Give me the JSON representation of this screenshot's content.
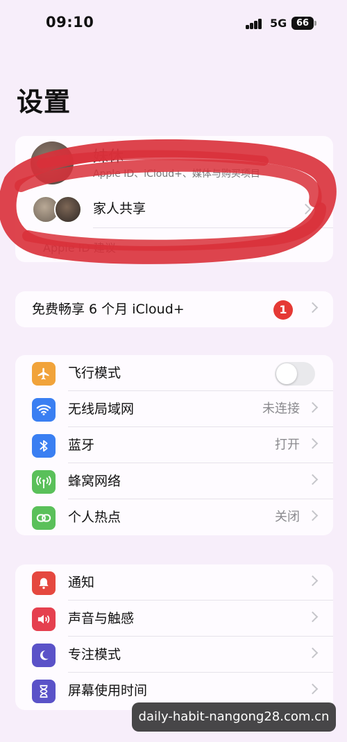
{
  "status_bar": {
    "time": "09:10",
    "network": "5G",
    "battery": "66"
  },
  "page_title": "设置",
  "profile": {
    "name_partial": "妹休",
    "subtitle_partial": "Apple ID、iCloud+、媒体与购买项目",
    "family_sharing_label": "家人共享",
    "apple_id_suggestions_label": "Apple ID 建议"
  },
  "icloud_promo": {
    "label": "免费畅享 6 个月 iCloud+",
    "badge_count": "1"
  },
  "connectivity": [
    {
      "label": "飞行模式",
      "value": "",
      "icon": "airplane-icon",
      "color": "#f1a33a",
      "toggle": true,
      "toggle_on": false
    },
    {
      "label": "无线局域网",
      "value": "未连接",
      "icon": "wifi-icon",
      "color": "#3a7ff2"
    },
    {
      "label": "蓝牙",
      "value": "打开",
      "icon": "bluetooth-icon",
      "color": "#3a7ff2"
    },
    {
      "label": "蜂窝网络",
      "value": "",
      "icon": "cellular-antenna-icon",
      "color": "#5ac05a"
    },
    {
      "label": "个人热点",
      "value": "关闭",
      "icon": "hotspot-chain-icon",
      "color": "#5ac05a"
    }
  ],
  "system": [
    {
      "label": "通知",
      "icon": "notification-bell-icon",
      "color": "#e5483f"
    },
    {
      "label": "声音与触感",
      "icon": "speaker-icon",
      "color": "#e5404f"
    },
    {
      "label": "专注模式",
      "icon": "moon-icon",
      "color": "#5a52c8"
    },
    {
      "label": "屏幕使用时间",
      "icon": "hourglass-icon",
      "color": "#5a52c8"
    }
  ],
  "watermark": "daily-habit-nangong28.com.cn",
  "colors": {
    "background": "#f7eefa",
    "redaction": "#d9303a"
  }
}
